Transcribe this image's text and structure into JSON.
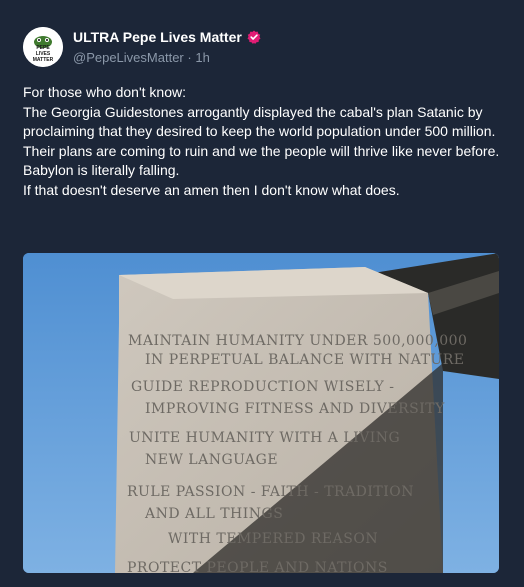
{
  "author": {
    "display_name": "ULTRA Pepe Lives Matter",
    "handle": "@PepeLivesMatter",
    "separator": "·",
    "time_ago": "1h",
    "avatar_text_line1": "PEPE",
    "avatar_text_line2": "LIVES",
    "avatar_text_line3": "MATTER",
    "avatar_icon": "pepe-frog-logo",
    "verified_icon": "verified-badge-icon",
    "verified_color": "#e11d74"
  },
  "post": {
    "paragraphs": [
      "For those who don't know:",
      "The Georgia Guidestones arrogantly displayed the cabal's plan Satanic by proclaiming that they desired to keep the world population under 500 million.",
      "Their plans are coming to ruin and we the people will thrive like never before.",
      "Babylon is literally falling.",
      "If that doesn't deserve an amen then I don't know what does."
    ]
  },
  "image": {
    "inscription": [
      "MAINTAIN HUMANITY UNDER 500,000,000",
      "IN PERPETUAL BALANCE WITH NATURE",
      "GUIDE REPRODUCTION  WISELY -",
      "IMPROVING FITNESS AND DIVERSITY",
      "UNITE HUMANITY WITH A LIVING",
      "NEW LANGUAGE",
      "RULE PASSION - FAITH - TRADITION",
      "AND ALL THINGS",
      "WITH TEMPERED REASON",
      "PROTECT PEOPLE AND NATIONS"
    ]
  },
  "colors": {
    "background": "#1c2638",
    "text": "#ffffff",
    "muted": "#8b98a9",
    "sky": "#5f99d6",
    "stone": "#c9c2b8"
  }
}
